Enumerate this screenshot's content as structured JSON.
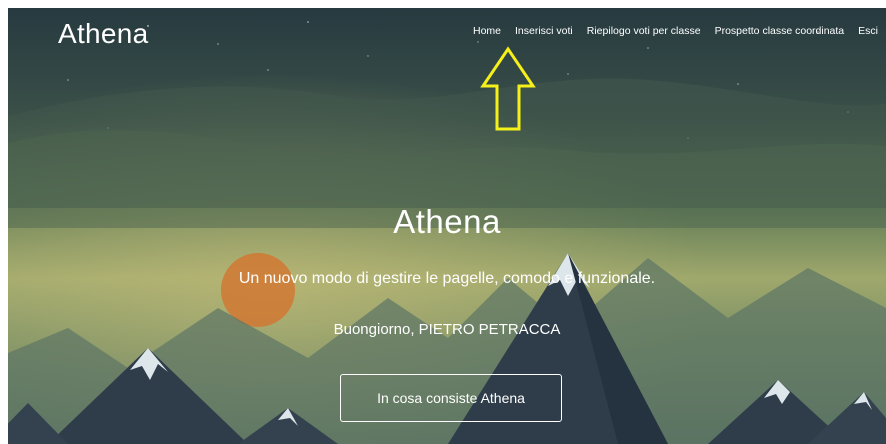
{
  "header": {
    "brand": "Athena"
  },
  "nav": {
    "items": [
      {
        "label": "Home"
      },
      {
        "label": "Inserisci voti"
      },
      {
        "label": "Riepilogo voti per classe"
      },
      {
        "label": "Prospetto classe coordinata"
      },
      {
        "label": "Esci"
      }
    ]
  },
  "hero": {
    "title": "Athena",
    "subtitle": "Un nuovo modo di gestire le pagelle, comodo e funzionale.",
    "greeting": "Buongiorno, PIETRO PETRACCA",
    "cta_label": "In cosa consiste Athena"
  },
  "colors": {
    "sky_top": "#2b3f44",
    "sky_mid": "#5e7b55",
    "sky_glow": "#b1b57a",
    "sun": "#cf7a34",
    "mountain_dark": "#2e3b48",
    "snow": "#dde6ea",
    "annotation_arrow": "#f5ef1a"
  }
}
